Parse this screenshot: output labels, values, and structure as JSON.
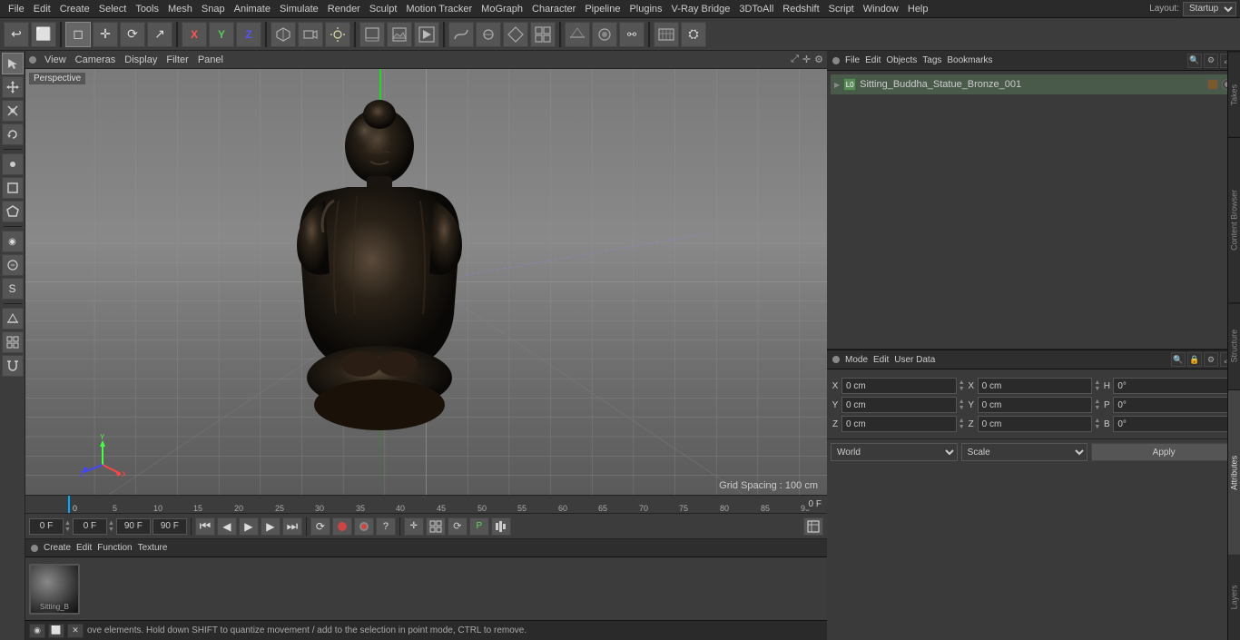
{
  "menu": {
    "items": [
      "File",
      "Edit",
      "Create",
      "Select",
      "Tools",
      "Mesh",
      "Snap",
      "Animate",
      "Simulate",
      "Render",
      "Sculpt",
      "Motion Tracker",
      "MoGraph",
      "Character",
      "Pipeline",
      "Plugins",
      "V-Ray Bridge",
      "3DToAll",
      "Redshift",
      "Script",
      "Window",
      "Help"
    ],
    "layout_label": "Layout:",
    "layout_value": "Startup"
  },
  "toolbar": {
    "buttons": [
      "↩",
      "⬜",
      "✛",
      "⟳",
      "↗",
      "X",
      "Y",
      "Z",
      "◻",
      "↔",
      "◈",
      "△",
      "⬡",
      "◉",
      "☁",
      "⚯",
      "⬛",
      "▷",
      "⊕",
      "☆",
      "◎",
      "⊟",
      "⊞",
      "▦",
      "◫"
    ]
  },
  "left_tools": [
    "◻",
    "✛",
    "⟳",
    "◈",
    "△",
    "⬡",
    "◻",
    "◎",
    "⊕",
    "☆",
    "S",
    "⊟"
  ],
  "viewport": {
    "label": "Perspective",
    "grid_spacing": "Grid Spacing : 100 cm",
    "menu_items": [
      "View",
      "Cameras",
      "Display",
      "Filter",
      "Panel"
    ]
  },
  "timeline": {
    "ticks": [
      "0",
      "5",
      "10",
      "15",
      "20",
      "25",
      "30",
      "35",
      "40",
      "45",
      "50",
      "55",
      "60",
      "65",
      "70",
      "75",
      "80",
      "85",
      "90"
    ],
    "current_frame_display": "0 F"
  },
  "transport": {
    "frame_start": "0 F",
    "frame_current": "0 F",
    "frame_end": "90 F",
    "frame_max": "90 F"
  },
  "objects_panel": {
    "header_items": [
      "File",
      "Edit",
      "Objects",
      "Tags",
      "Bookmarks"
    ],
    "object_name": "Sitting_Buddha_Statue_Bronze_001",
    "object_prefix": "L0"
  },
  "attributes_panel": {
    "header_items": [
      "Mode",
      "Edit",
      "User Data"
    ],
    "coords": {
      "x_pos": "0 cm",
      "y_pos": "0 cm",
      "z_pos": "0 cm",
      "x_rot": "0°",
      "y_rot": "0°",
      "z_rot": "0°",
      "x_size": "H",
      "p_val": "0°",
      "b_val": "0°"
    },
    "rows": [
      {
        "label": "X",
        "val1": "0 cm",
        "arrow1": "▲",
        "label2": "X",
        "val2": "0 cm",
        "label3": "H",
        "val3": "0°"
      },
      {
        "label": "Y",
        "val1": "0 cm",
        "arrow1": "▲",
        "label2": "Y",
        "val2": "0 cm",
        "label3": "P",
        "val3": "0°"
      },
      {
        "label": "Z",
        "val1": "0 cm",
        "arrow1": "▲",
        "label2": "Z",
        "val2": "0 cm",
        "label3": "B",
        "val3": "0°"
      }
    ],
    "world_label": "World",
    "scale_label": "Scale",
    "apply_label": "Apply"
  },
  "material": {
    "name": "Sitting_B",
    "label": "Create",
    "menu_items": [
      "Create",
      "Edit",
      "Function",
      "Texture"
    ]
  },
  "status": {
    "text": "ove elements. Hold down SHIFT to quantize movement / add to the selection in point mode, CTRL to remove.",
    "frame": "0 F",
    "frame_end": "0 F"
  },
  "side_tabs": [
    "Takes",
    "Content Browser",
    "Structure",
    "Attributes",
    "Layers"
  ],
  "icons": {
    "undo": "↩",
    "redo": "↪",
    "play": "▶",
    "stop": "■",
    "prev": "⏮",
    "next": "⏭",
    "prev_frame": "◀",
    "next_frame": "▶",
    "record": "⏺",
    "auto": "A",
    "question": "?"
  }
}
